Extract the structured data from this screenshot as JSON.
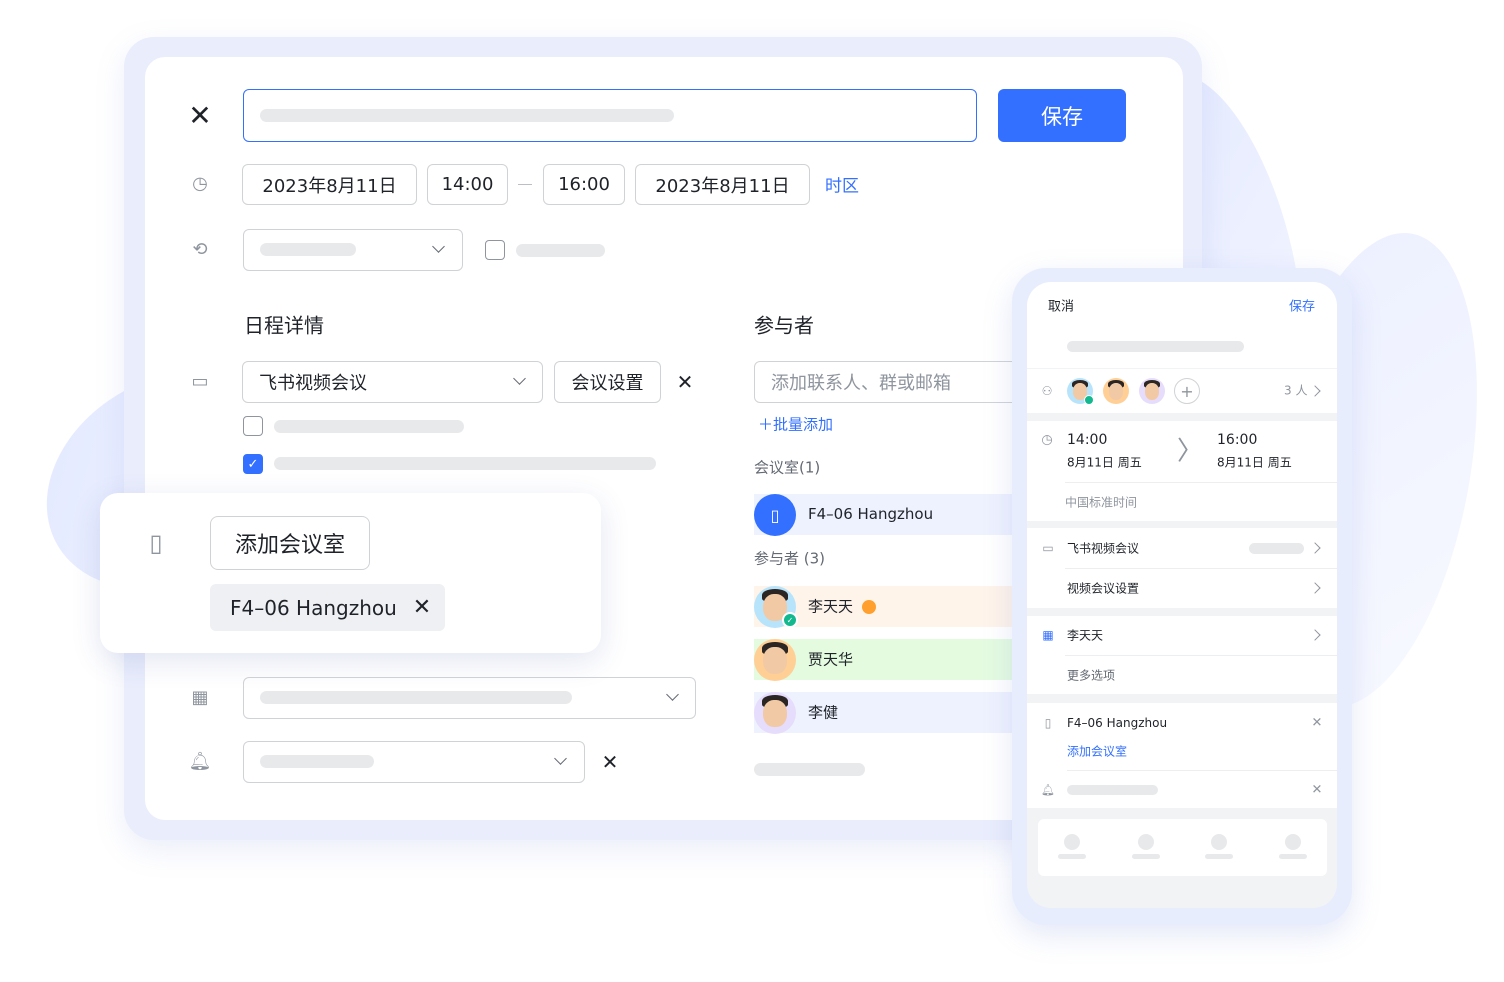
{
  "colors": {
    "accent": "#3370ff",
    "room_row": "#eef2fe",
    "attendee1": "#fef4ea",
    "attendee2": "#e4fbe0",
    "attendee3": "#eef2fe",
    "accepted": "#14b88f",
    "pending": "#ff9f2e"
  },
  "desktop": {
    "save_label": "保存",
    "start_date": "2023年8月11日",
    "start_time": "14:00",
    "end_time": "16:00",
    "end_date": "2023年8月11日",
    "timezone_label": "时区",
    "details_heading": "日程详情",
    "video_meeting": "飞书视频会议",
    "meeting_settings": "会议设置",
    "attendees_heading": "参与者",
    "attendee_placeholder": "添加联系人、群或邮箱",
    "bulk_add": "批量添加",
    "rooms_label": "会议室(1)",
    "room_name": "F4–06 Hangzhou",
    "attendees_count_label": "参与者 (3)",
    "attendees": [
      {
        "name": "李天天",
        "status": "accepted",
        "pending_icon": "clock-icon"
      },
      {
        "name": "贾天华"
      },
      {
        "name": "李健"
      }
    ]
  },
  "popover": {
    "add_room": "添加会议室",
    "room_chip": "F4–06 Hangzhou"
  },
  "mobile": {
    "cancel": "取消",
    "save": "保存",
    "attendee_count": "3 人",
    "start_time": "14:00",
    "start_date": "8月11日 周五",
    "end_time": "16:00",
    "end_date": "8月11日 周五",
    "timezone": "中国标准时间",
    "video_meeting": "飞书视频会议",
    "video_settings": "视频会议设置",
    "calendar_owner": "李天天",
    "more_options": "更多选项",
    "room_name": "F4–06 Hangzhou",
    "add_room": "添加会议室"
  }
}
